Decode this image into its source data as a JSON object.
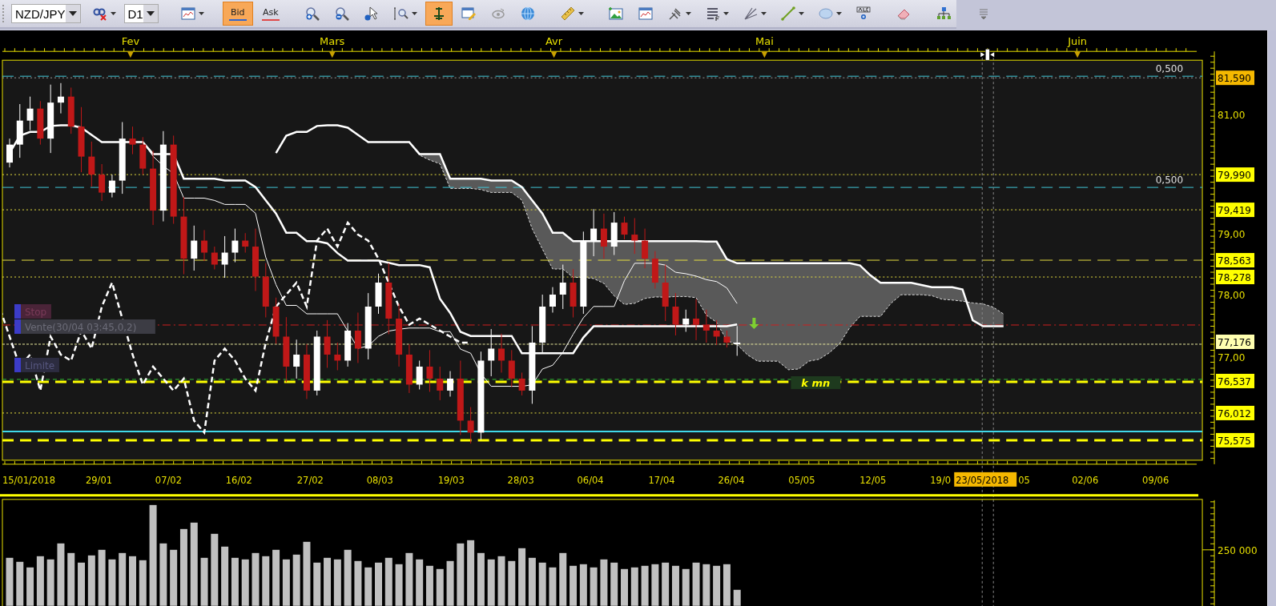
{
  "toolbar": {
    "items": [
      {
        "kind": "field",
        "value": "NZD/JPY"
      },
      {
        "kind": "icon",
        "selected": false,
        "dropdown": true
      },
      {
        "kind": "field",
        "value": "D1"
      },
      {
        "kind": "separator"
      },
      {
        "kind": "icon",
        "selected": false,
        "dropdown": true
      },
      {
        "kind": "separator"
      },
      {
        "kind": "toggle",
        "label": "Bid",
        "selected": true,
        "color": "#3366cc"
      },
      {
        "kind": "toggle",
        "label": "Ask",
        "selected": false,
        "color": "#e04848"
      },
      {
        "kind": "separator"
      },
      {
        "kind": "icon",
        "selected": false,
        "dropdown": false
      },
      {
        "kind": "icon",
        "selected": false,
        "dropdown": false
      },
      {
        "kind": "icon",
        "selected": false,
        "dropdown": false
      },
      {
        "kind": "icon",
        "selected": false,
        "dropdown": true
      },
      {
        "kind": "icon",
        "selected": true,
        "dropdown": false
      },
      {
        "kind": "icon",
        "selected": false,
        "dropdown": false
      },
      {
        "kind": "icon",
        "selected": false,
        "dropdown": false
      },
      {
        "kind": "icon",
        "selected": false,
        "dropdown": false
      },
      {
        "kind": "separator"
      },
      {
        "kind": "icon",
        "selected": false,
        "dropdown": true
      },
      {
        "kind": "separator"
      },
      {
        "kind": "icon",
        "selected": false,
        "dropdown": false
      },
      {
        "kind": "icon",
        "selected": false,
        "dropdown": false
      },
      {
        "kind": "icon",
        "selected": false,
        "dropdown": true
      },
      {
        "kind": "icon",
        "selected": false,
        "dropdown": true
      },
      {
        "kind": "icon",
        "selected": false,
        "dropdown": true
      },
      {
        "kind": "icon",
        "selected": false,
        "dropdown": true
      },
      {
        "kind": "icon",
        "selected": false,
        "dropdown": true
      },
      {
        "kind": "icon",
        "selected": false,
        "dropdown": false
      },
      {
        "kind": "separator"
      },
      {
        "kind": "icon",
        "selected": false,
        "dropdown": false
      },
      {
        "kind": "separator"
      },
      {
        "kind": "icon",
        "selected": false,
        "dropdown": false
      },
      {
        "kind": "separator"
      },
      {
        "kind": "icon",
        "selected": false,
        "dropdown": false
      }
    ]
  },
  "chart": {
    "months": [
      "Fev",
      "Mars",
      "Avr",
      "Mai",
      "Juin"
    ],
    "level_labels": [
      "0,500",
      "0,500"
    ],
    "price_labels": [
      {
        "text": "81,590",
        "kind": "cursor"
      },
      {
        "text": "81,00",
        "kind": "tick"
      },
      {
        "text": "79,990",
        "kind": "level"
      },
      {
        "text": "79,419",
        "kind": "level"
      },
      {
        "text": "79,00",
        "kind": "tick"
      },
      {
        "text": "78,563",
        "kind": "level"
      },
      {
        "text": "78,278",
        "kind": "level"
      },
      {
        "text": "78,00",
        "kind": "tick"
      },
      {
        "text": "77,176",
        "kind": "last"
      },
      {
        "text": "77,00",
        "kind": "tick"
      },
      {
        "text": "76,537",
        "kind": "level"
      },
      {
        "text": "76,012",
        "kind": "level"
      },
      {
        "text": "75,575",
        "kind": "level"
      }
    ],
    "orders": [
      {
        "label": "Stop",
        "kind": "stop"
      },
      {
        "label": "Vente(30/04 03:45,0,2)",
        "kind": "entry"
      },
      {
        "label": "Limite",
        "kind": "limit"
      }
    ],
    "annotation": "k mn",
    "dates": [
      "15/01/2018",
      "29/01",
      "07/02",
      "16/02",
      "27/02",
      "08/03",
      "19/03",
      "28/03",
      "06/04",
      "17/04",
      "26/04",
      "05/05",
      "12/05",
      "19/0",
      "05",
      "02/06",
      "09/06"
    ],
    "cursor_date": "23/05/2018"
  },
  "volume": {
    "axis_labels": [
      "250 000"
    ]
  }
}
